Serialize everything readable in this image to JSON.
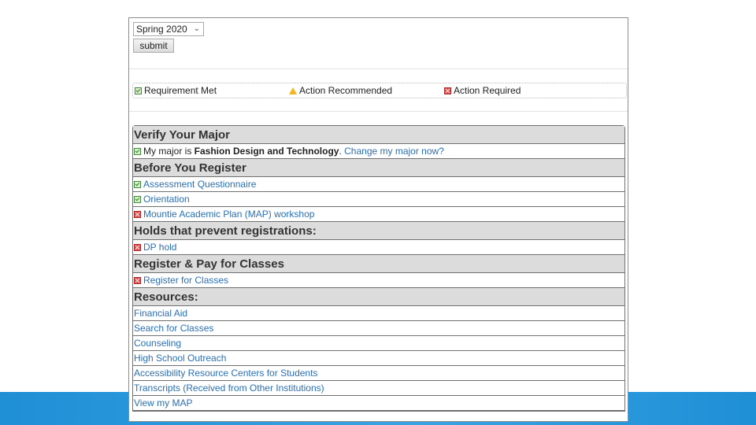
{
  "term_selector": {
    "value": "Spring 2020"
  },
  "submit_label": "submit",
  "legend": {
    "met": "Requirement Met",
    "recommended": "Action Recommended",
    "required": "Action Required"
  },
  "sections": {
    "verify": {
      "heading": "Verify Your Major",
      "major_prefix": "My major is ",
      "major_name": "Fashion Design and Technology",
      "major_suffix": ". ",
      "change_link": "Change my major now?"
    },
    "before": {
      "heading": "Before You Register",
      "items": [
        "Assessment Questionnaire",
        "Orientation",
        "Mountie Academic Plan (MAP) workshop"
      ]
    },
    "holds": {
      "heading": "Holds that prevent registrations:",
      "items": [
        "DP hold"
      ]
    },
    "register": {
      "heading": "Register & Pay for Classes",
      "items": [
        "Register for Classes"
      ]
    },
    "resources": {
      "heading": "Resources:",
      "items": [
        "Financial Aid",
        "Search for Classes",
        "Counseling",
        "High School Outreach",
        "Accessibility Resource Centers for Students",
        "Transcripts (Received from Other Institutions)",
        "View my MAP"
      ]
    }
  },
  "colors": {
    "accent_bar": "#2a96dc",
    "link": "#2a6fb5",
    "section_bg": "#dcdcdc",
    "ok": "#3e8a3e",
    "error": "#e04848",
    "warning": "#f2b51f"
  }
}
